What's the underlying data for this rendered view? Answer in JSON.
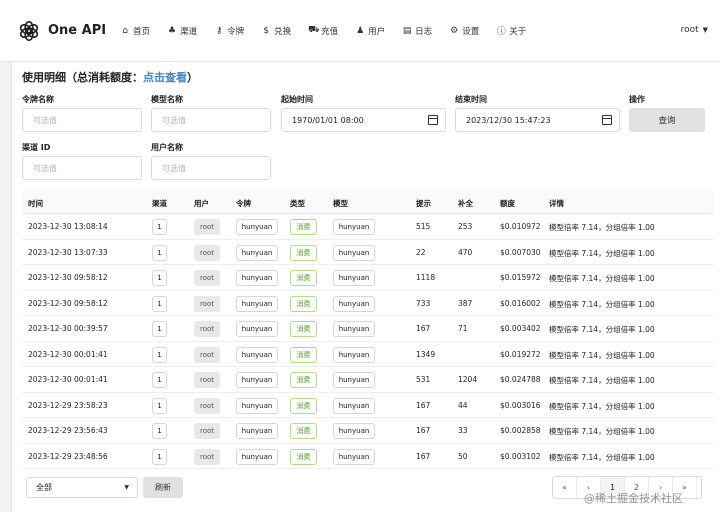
{
  "brand": {
    "name": "One API"
  },
  "nav": [
    {
      "label": "首页",
      "icon": "home-icon"
    },
    {
      "label": "渠道",
      "icon": "sitemap-icon"
    },
    {
      "label": "令牌",
      "icon": "key-icon"
    },
    {
      "label": "兑换",
      "icon": "dollar-icon"
    },
    {
      "label": "充值",
      "icon": "cart-icon"
    },
    {
      "label": "用户",
      "icon": "user-icon"
    },
    {
      "label": "日志",
      "icon": "book-icon"
    },
    {
      "label": "设置",
      "icon": "gear-icon"
    },
    {
      "label": "关于",
      "icon": "info-icon"
    }
  ],
  "user_menu": {
    "label": "root"
  },
  "card": {
    "title_prefix": "使用明细（总消耗额度：",
    "title_link": "点击查看",
    "title_suffix": "）"
  },
  "filters": {
    "token_name": {
      "label": "令牌名称",
      "placeholder": "可选值"
    },
    "model_name": {
      "label": "模型名称",
      "placeholder": "可选值"
    },
    "start_time": {
      "label": "起始时间",
      "value": "1970/01/01 08:00"
    },
    "end_time": {
      "label": "结束时间",
      "value": "2023/12/30 15:47:23"
    },
    "action": {
      "label": "操作",
      "button": "查询"
    },
    "channel_id": {
      "label": "渠道 ID",
      "placeholder": "可选值"
    },
    "username": {
      "label": "用户名称",
      "placeholder": "可选值"
    }
  },
  "table": {
    "columns": [
      "时间",
      "渠道",
      "用户",
      "令牌",
      "类型",
      "模型",
      "提示",
      "补全",
      "额度",
      "详情"
    ],
    "rows": [
      {
        "time": "2023-12-30 13:08:14",
        "channel": "1",
        "user": "root",
        "token": "hunyuan",
        "type": "消费",
        "model": "hunyuan",
        "prompt": "515",
        "completion": "253",
        "quota": "$0.010972",
        "detail": "模型倍率 7.14，分组倍率 1.00"
      },
      {
        "time": "2023-12-30 13:07:33",
        "channel": "1",
        "user": "root",
        "token": "hunyuan",
        "type": "消费",
        "model": "hunyuan",
        "prompt": "22",
        "completion": "470",
        "quota": "$0.007030",
        "detail": "模型倍率 7.14，分组倍率 1.00"
      },
      {
        "time": "2023-12-30 09:58:12",
        "channel": "1",
        "user": "root",
        "token": "hunyuan",
        "type": "消费",
        "model": "hunyuan",
        "prompt": "1118",
        "completion": "",
        "quota": "$0.015972",
        "detail": "模型倍率 7.14，分组倍率 1.00"
      },
      {
        "time": "2023-12-30 09:58:12",
        "channel": "1",
        "user": "root",
        "token": "hunyuan",
        "type": "消费",
        "model": "hunyuan",
        "prompt": "733",
        "completion": "387",
        "quota": "$0.016002",
        "detail": "模型倍率 7.14，分组倍率 1.00"
      },
      {
        "time": "2023-12-30 00:39:57",
        "channel": "1",
        "user": "root",
        "token": "hunyuan",
        "type": "消费",
        "model": "hunyuan",
        "prompt": "167",
        "completion": "71",
        "quota": "$0.003402",
        "detail": "模型倍率 7.14，分组倍率 1.00"
      },
      {
        "time": "2023-12-30 00:01:41",
        "channel": "1",
        "user": "root",
        "token": "hunyuan",
        "type": "消费",
        "model": "hunyuan",
        "prompt": "1349",
        "completion": "",
        "quota": "$0.019272",
        "detail": "模型倍率 7.14，分组倍率 1.00"
      },
      {
        "time": "2023-12-30 00:01:41",
        "channel": "1",
        "user": "root",
        "token": "hunyuan",
        "type": "消费",
        "model": "hunyuan",
        "prompt": "531",
        "completion": "1204",
        "quota": "$0.024788",
        "detail": "模型倍率 7.14，分组倍率 1.00"
      },
      {
        "time": "2023-12-29 23:58:23",
        "channel": "1",
        "user": "root",
        "token": "hunyuan",
        "type": "消费",
        "model": "hunyuan",
        "prompt": "167",
        "completion": "44",
        "quota": "$0.003016",
        "detail": "模型倍率 7.14，分组倍率 1.00"
      },
      {
        "time": "2023-12-29 23:56:43",
        "channel": "1",
        "user": "root",
        "token": "hunyuan",
        "type": "消费",
        "model": "hunyuan",
        "prompt": "167",
        "completion": "33",
        "quota": "$0.002858",
        "detail": "模型倍率 7.14，分组倍率 1.00"
      },
      {
        "time": "2023-12-29 23:48:56",
        "channel": "1",
        "user": "root",
        "token": "hunyuan",
        "type": "消费",
        "model": "hunyuan",
        "prompt": "167",
        "completion": "50",
        "quota": "$0.003102",
        "detail": "模型倍率 7.14，分组倍率 1.00"
      }
    ]
  },
  "footer": {
    "select_value": "全部",
    "refresh_button": "刷新",
    "pagination": [
      "«",
      "‹",
      "1",
      "2",
      "›",
      "»"
    ],
    "active_page": "1"
  },
  "watermark": "@稀土掘金技术社区",
  "colors": {
    "accent_link": "#4183c4",
    "type_green": "#5aa23a"
  }
}
